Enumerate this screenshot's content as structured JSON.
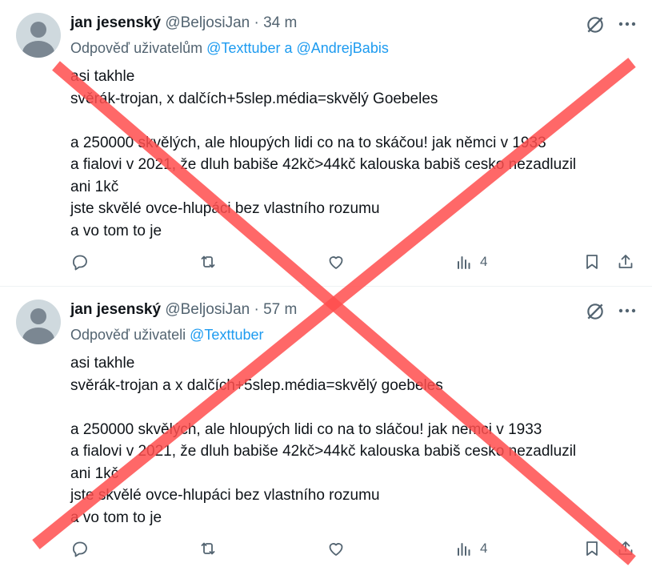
{
  "tweets": [
    {
      "name": "jan jesenský",
      "handle": "@BeljosiJan",
      "dot": "·",
      "time": "34 m",
      "reply_prefix": "Odpověď uživatelům",
      "reply_mentions": "@Texttuber a @AndrejBabis",
      "body_lines": [
        "asi takhle",
        "svěrák-trojan, x dalčích+5slep.média=skvělý Goebeles",
        "",
        "a 250000 skvělých, ale hloupých lidi co na to skáčou! jak němci v 1933",
        "a fialovi v 2021, že dluh babiše 42kč>44kč kalouska babiš cesko nezadluzil",
        "ani 1kč",
        "jste skvělé ovce-hlupáci bez vlastního rozumu",
        "a vo tom to je"
      ],
      "views": "4"
    },
    {
      "name": "jan jesenský",
      "handle": "@BeljosiJan",
      "dot": "·",
      "time": "57 m",
      "reply_prefix": "Odpověď uživateli",
      "reply_mentions": "@Texttuber",
      "body_lines": [
        "asi takhle",
        "svěrák-trojan a x dalčích+5slep.média=skvělý goebeles",
        "",
        "a 250000 skvělých, ale hloupých lidi co na to sláčou! jak nemci v 1933",
        "a fialovi v 2021, že dluh babiše 42kč>44kč kalouska babiš cesko nezadluzil",
        "ani 1kč",
        "jste skvělé ovce-hlupáci bez vlastního rozumu",
        "a vo tom to je"
      ],
      "views": "4"
    }
  ],
  "icons": {
    "avatar": "default-avatar-icon",
    "grok": "grok-icon",
    "more": "more-icon",
    "reply": "reply-icon",
    "retweet": "retweet-icon",
    "like": "like-icon",
    "views": "views-icon",
    "bookmark": "bookmark-icon",
    "share": "share-icon"
  },
  "colors": {
    "text": "#0f1419",
    "secondary": "#536471",
    "link": "#1d9bf0",
    "divider": "#eff3f4",
    "overlay_cross": "#ff4d4d"
  }
}
